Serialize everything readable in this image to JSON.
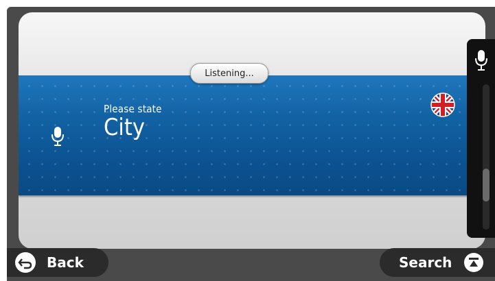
{
  "voice_prompt": {
    "status_badge": "Listening...",
    "instruction": "Please state",
    "field": "City"
  },
  "icons": {
    "mic": "microphone-icon",
    "language": "uk-flag-icon",
    "back": "back-arrow-icon",
    "search": "search-scroll-up-icon"
  },
  "scrollbar": {
    "position": 0.75
  },
  "buttons": {
    "back_label": "Back",
    "search_label": "Search"
  },
  "colors": {
    "banner": "#1262a3",
    "button_bg": "#2b2b2b",
    "frame": "#4a4a4a"
  }
}
